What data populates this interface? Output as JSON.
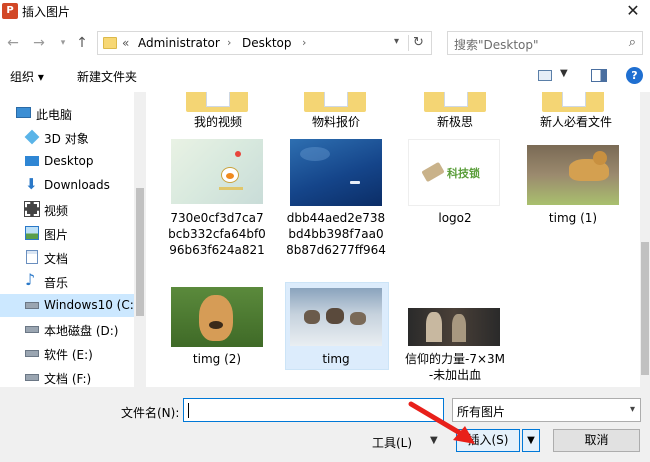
{
  "window": {
    "title": "插入图片",
    "app_icon": "P"
  },
  "nav": {
    "address_root": "«",
    "address_segments": [
      "Administrator",
      "Desktop"
    ],
    "search_placeholder": "搜索\"Desktop\""
  },
  "toolbar": {
    "organize": "组织 ▾",
    "new_folder": "新建文件夹"
  },
  "sidebar": {
    "items": [
      {
        "label": "此电脑",
        "icon": "computer-icon"
      },
      {
        "label": "3D 对象",
        "icon": "cube-icon"
      },
      {
        "label": "Desktop",
        "icon": "desktop-icon"
      },
      {
        "label": "Downloads",
        "icon": "download-icon"
      },
      {
        "label": "视频",
        "icon": "video-icon"
      },
      {
        "label": "图片",
        "icon": "picture-icon"
      },
      {
        "label": "文档",
        "icon": "document-icon"
      },
      {
        "label": "音乐",
        "icon": "music-icon"
      },
      {
        "label": "Windows10 (C:",
        "icon": "drive-c-icon"
      },
      {
        "label": "本地磁盘 (D:)",
        "icon": "drive-icon"
      },
      {
        "label": "软件 (E:)",
        "icon": "drive-icon"
      },
      {
        "label": "文档 (F:)",
        "icon": "drive-icon"
      }
    ]
  },
  "folders": [
    {
      "label": "我的视频"
    },
    {
      "label": "物料报价"
    },
    {
      "label": "新极思"
    },
    {
      "label": "新人必看文件"
    }
  ],
  "files": [
    {
      "label": "730e0cf3d7ca7bcb332cfa64bf096b63f624a821"
    },
    {
      "label": "dbb44aed2e738bd4bb398f7aa08b87d6277ff964"
    },
    {
      "label": "logo2",
      "thumb_text": "科技锁"
    },
    {
      "label": "timg (1)"
    },
    {
      "label": "timg (2)"
    },
    {
      "label": "timg"
    },
    {
      "label": "信仰的力量-7×3M-未加出血"
    }
  ],
  "bottom": {
    "filename_label": "文件名(N):",
    "filename_value": "",
    "filter_value": "所有图片",
    "tools_label": "工具(L)",
    "insert_label": "插入(S)",
    "cancel_label": "取消"
  }
}
